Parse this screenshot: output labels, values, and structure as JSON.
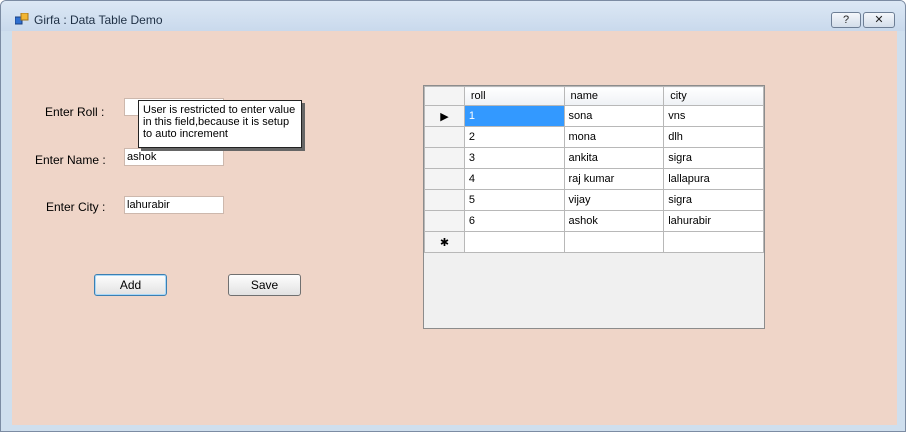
{
  "window": {
    "title": "Girfa : Data Table Demo",
    "help_label": "?",
    "close_label": "✕"
  },
  "form": {
    "roll_label": "Enter Roll :",
    "name_label": "Enter Name :",
    "city_label": "Enter City :",
    "roll_value": "",
    "name_value": "ashok",
    "city_value": "lahurabir",
    "add_label": "Add",
    "save_label": "Save",
    "tooltip": "User is restricted to enter value in this field,because it is setup to auto increment"
  },
  "grid": {
    "columns": [
      "roll",
      "name",
      "city"
    ],
    "rows": [
      [
        "1",
        "sona",
        "vns"
      ],
      [
        "2",
        "mona",
        "dlh"
      ],
      [
        "3",
        "ankita",
        "sigra"
      ],
      [
        "4",
        "raj kumar",
        "lallapura"
      ],
      [
        "5",
        "vijay",
        "sigra"
      ],
      [
        "6",
        "ashok",
        "lahurabir"
      ]
    ],
    "current_row_marker": "▶",
    "new_row_marker": "✱"
  }
}
